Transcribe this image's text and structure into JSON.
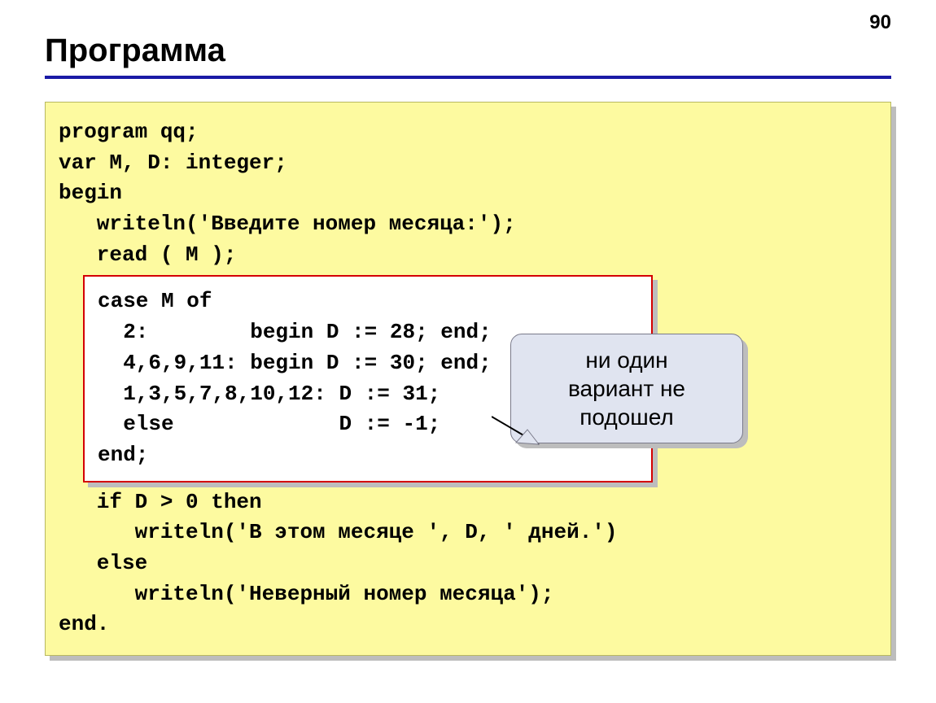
{
  "page_number": "90",
  "title": "Программа",
  "code": {
    "before": "program qq;\nvar M, D: integer;\nbegin\n   writeln('Введите номер месяца:');\n   read ( M );",
    "highlight": "case M of\n  2:        begin D := 28; end;\n  4,6,9,11: begin D := 30; end;\n  1,3,5,7,8,10,12: D := 31;\n  else             D := -1;\nend;",
    "after": "   if D > 0 then\n      writeln('В этом месяце ', D, ' дней.')\n   else\n      writeln('Неверный номер месяца');\nend."
  },
  "callout": "ни один\nвариант не\nподошел"
}
